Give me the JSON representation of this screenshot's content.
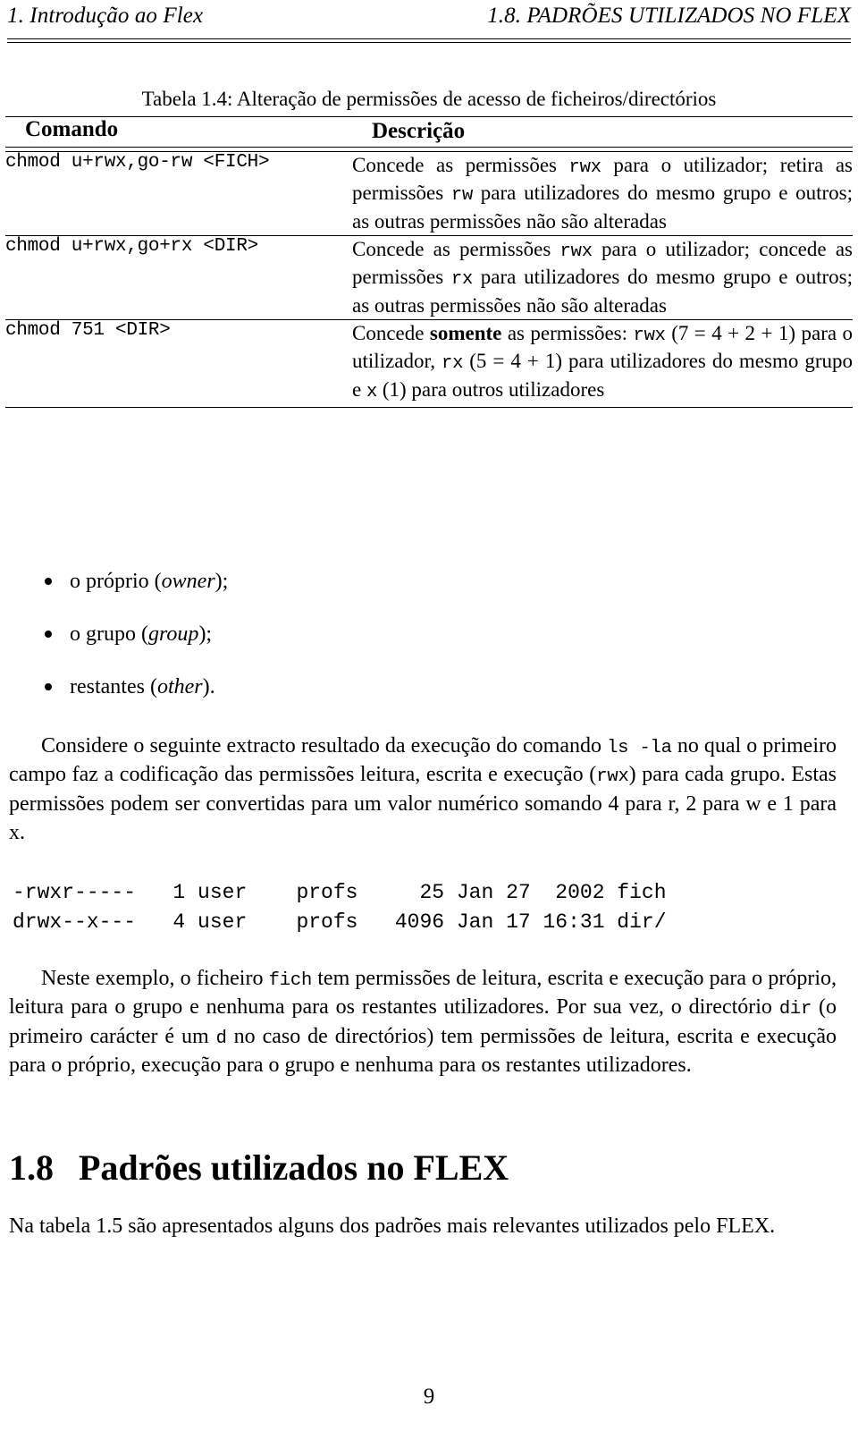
{
  "running_header": {
    "left": "1. Introdução ao Flex",
    "right": "1.8.  PADRÕES UTILIZADOS NO FLEX"
  },
  "table": {
    "caption": "Tabela 1.4: Alteração de permissões de acesso de ficheiros/directórios",
    "columns": [
      "Comando",
      "Descrição"
    ],
    "rows": [
      {
        "command": "chmod u+rwx,go-rw <FICH>",
        "description_parts": [
          {
            "text": "Concede as permissões ",
            "style": "roman"
          },
          {
            "text": "rwx",
            "style": "mono"
          },
          {
            "text": " para o utilizador; retira as permissões ",
            "style": "roman"
          },
          {
            "text": "rw",
            "style": "mono"
          },
          {
            "text": " para utilizadores do mesmo grupo e outros; as outras permissões não são alteradas",
            "style": "roman"
          }
        ]
      },
      {
        "command": "chmod u+rwx,go+rx <DIR>",
        "description_parts": [
          {
            "text": "Concede as permissões ",
            "style": "roman"
          },
          {
            "text": "rwx",
            "style": "mono"
          },
          {
            "text": " para o utilizador; concede as permissões ",
            "style": "roman"
          },
          {
            "text": "rx",
            "style": "mono"
          },
          {
            "text": " para utilizadores do mesmo grupo e outros; as outras permissões não são alteradas",
            "style": "roman"
          }
        ]
      },
      {
        "command": "chmod 751 <DIR>",
        "description_parts": [
          {
            "text": "Concede ",
            "style": "roman"
          },
          {
            "text": "somente",
            "style": "bold"
          },
          {
            "text": " as permissões: ",
            "style": "roman"
          },
          {
            "text": "rwx",
            "style": "mono"
          },
          {
            "text": " (7 = 4 + 2 + 1)",
            "style": "math"
          },
          {
            "text": " para o utilizador, ",
            "style": "roman"
          },
          {
            "text": "rx",
            "style": "mono"
          },
          {
            "text": " (5 = 4 + 1)",
            "style": "math"
          },
          {
            "text": " para utilizadores do mesmo grupo e ",
            "style": "roman"
          },
          {
            "text": "x",
            "style": "mono"
          },
          {
            "text": " (1)",
            "style": "math"
          },
          {
            "text": " para outros utilizadores",
            "style": "roman"
          }
        ]
      }
    ]
  },
  "bullets": [
    {
      "label": "o próprio (",
      "italic": "owner",
      "tail": ");"
    },
    {
      "label": "o grupo (",
      "italic": "group",
      "tail": ");"
    },
    {
      "label": "restantes (",
      "italic": "other",
      "tail": ")."
    }
  ],
  "paragraph_1": {
    "parts": [
      {
        "text": "Considere o seguinte extracto resultado da execução do comando ",
        "style": "roman"
      },
      {
        "text": "ls -la",
        "style": "mono"
      },
      {
        "text": " no qual o primeiro campo faz a codificação das permissões leitura, escrita e execução (",
        "style": "roman"
      },
      {
        "text": "rwx",
        "style": "mono"
      },
      {
        "text": ") para cada grupo. Estas permissões podem ser convertidas para um valor numérico somando 4 para r, 2 para w e 1 para x.",
        "style": "roman"
      }
    ]
  },
  "code_listing": {
    "lines": [
      "-rwxr-----   1 user    profs     25 Jan 27  2002 fich",
      "drwx--x---   4 user    profs   4096 Jan 17 16:31 dir/"
    ]
  },
  "paragraph_2": {
    "parts": [
      {
        "text": "Neste exemplo, o ficheiro ",
        "style": "roman"
      },
      {
        "text": "fich",
        "style": "mono"
      },
      {
        "text": " tem permissões de leitura, escrita e execução para o próprio, leitura para o grupo e nenhuma para os restantes utilizadores. Por sua vez, o directório ",
        "style": "roman"
      },
      {
        "text": "dir",
        "style": "mono"
      },
      {
        "text": " (o primeiro carácter é um ",
        "style": "roman"
      },
      {
        "text": "d",
        "style": "mono"
      },
      {
        "text": " no caso de directórios) tem permissões de leitura, escrita e execução para o próprio, execução para o grupo e nenhuma para os restantes utilizadores.",
        "style": "roman"
      }
    ]
  },
  "section_heading": {
    "number": "1.8",
    "title": "Padrões utilizados no FLEX"
  },
  "paragraph_3": {
    "text": "Na tabela 1.5 são apresentados alguns dos padrões mais relevantes utilizados pelo FLEX."
  },
  "page_number": "9"
}
